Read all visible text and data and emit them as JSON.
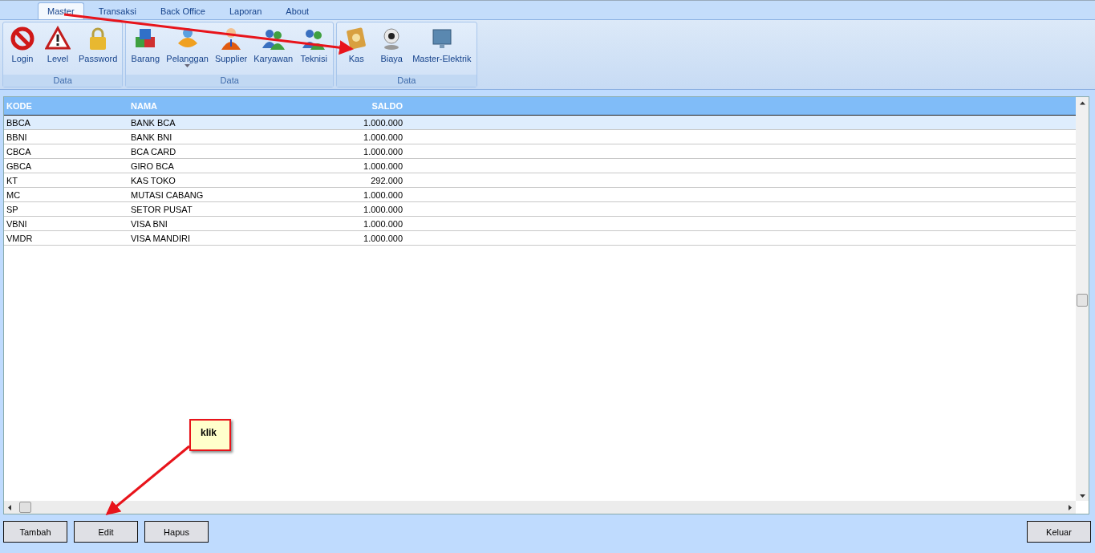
{
  "menu_tabs": [
    {
      "label": "Master",
      "selected": true
    },
    {
      "label": "Transaksi",
      "selected": false
    },
    {
      "label": "Back Office",
      "selected": false
    },
    {
      "label": "Laporan",
      "selected": false
    },
    {
      "label": "About",
      "selected": false
    }
  ],
  "ribbon_groups": [
    {
      "label": "Data",
      "items": [
        {
          "label": "Login",
          "dropdown": false
        },
        {
          "label": "Level",
          "dropdown": false
        },
        {
          "label": "Password",
          "dropdown": false
        }
      ]
    },
    {
      "label": "Data",
      "items": [
        {
          "label": "Barang",
          "dropdown": false
        },
        {
          "label": "Pelanggan",
          "dropdown": true
        },
        {
          "label": "Supplier",
          "dropdown": false
        },
        {
          "label": "Karyawan",
          "dropdown": false
        },
        {
          "label": "Teknisi",
          "dropdown": false
        }
      ]
    },
    {
      "label": "Data",
      "items": [
        {
          "label": "Kas",
          "dropdown": false
        },
        {
          "label": "Biaya",
          "dropdown": false
        },
        {
          "label": "Master-Elektrik",
          "dropdown": false
        }
      ]
    }
  ],
  "table": {
    "columns": [
      "KODE",
      "NAMA",
      "SALDO"
    ],
    "rows": [
      {
        "cells": [
          "BBCA",
          "BANK BCA",
          "1.000.000"
        ],
        "selected": true
      },
      {
        "cells": [
          "BBNI",
          "BANK BNI",
          "1.000.000"
        ],
        "selected": false
      },
      {
        "cells": [
          "CBCA",
          "BCA CARD",
          "1.000.000"
        ],
        "selected": false
      },
      {
        "cells": [
          "GBCA",
          "GIRO BCA",
          "1.000.000"
        ],
        "selected": false
      },
      {
        "cells": [
          "KT",
          "KAS TOKO",
          "292.000"
        ],
        "selected": false
      },
      {
        "cells": [
          "MC",
          "MUTASI CABANG",
          "1.000.000"
        ],
        "selected": false
      },
      {
        "cells": [
          "SP",
          "SETOR PUSAT",
          "1.000.000"
        ],
        "selected": false
      },
      {
        "cells": [
          "VBNI",
          "VISA BNI",
          "1.000.000"
        ],
        "selected": false
      },
      {
        "cells": [
          "VMDR",
          "VISA MANDIRI",
          "1.000.000"
        ],
        "selected": false
      }
    ]
  },
  "buttons": [
    "Tambah",
    "Edit",
    "Hapus"
  ],
  "exit_button": "Keluar",
  "callout": {
    "text": "klik"
  }
}
